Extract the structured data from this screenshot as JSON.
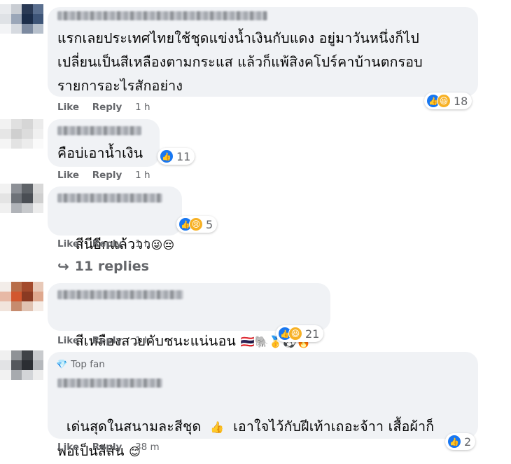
{
  "comments": [
    {
      "text": "แรกเลยประเทศไทยใช้ชุดแข่งน้ำเงินกับแดง อยู่มาวันหนึ่งก็ไป\nเปลี่ยนเป็นสีเหลืองตามกระแส แล้วก็แพ้สิงคโปร์คาบ้านตกรอบ\nรายการอะไรสักอย่าง",
      "like": "Like",
      "reply": "Reply",
      "time": "1 h",
      "reaction_count": "18"
    },
    {
      "text": "คือบ่เอาน้ำเงิน",
      "like": "Like",
      "reply": "Reply",
      "time": "1 h",
      "reaction_count": "11"
    },
    {
      "text": "สีนีอีกแล้ววว",
      "emoji": "😜😔",
      "like": "Like",
      "reply": "Reply",
      "time": "1 h",
      "reaction_count": "5"
    },
    {
      "text": "สีเหลืองสวยคับชนะแน่นอน",
      "emoji": "🇹🇭🐘🥇⚽🔥",
      "like": "Like",
      "reply": "Reply",
      "time": "1 h",
      "reaction_count": "21"
    },
    {
      "badge": "Top fan",
      "text": "เด่นสุดในสนามละสีชุด",
      "emoji_mid": "👍",
      "text2": "เอาใจไว้กับฝีเท้าเถอะจ้าา เสื้อผ้าก็\nพอเป็นสีสัน",
      "emoji_end": "😊",
      "like": "Like",
      "reply": "Reply",
      "time": "38 m",
      "reaction_count": "2"
    }
  ],
  "replies_link": "11 replies",
  "icons": {
    "like": "like-reaction-icon",
    "haha": "haha-reaction-icon",
    "sad": "sad-reaction-icon",
    "reply_arrow": "reply-arrow-icon",
    "top_fan": "diamond-icon"
  },
  "colors": {
    "bubble": "#f0f2f5",
    "meta": "#65676b",
    "like_blue": "#1877f2",
    "reaction_yellow": "#f7b125"
  }
}
